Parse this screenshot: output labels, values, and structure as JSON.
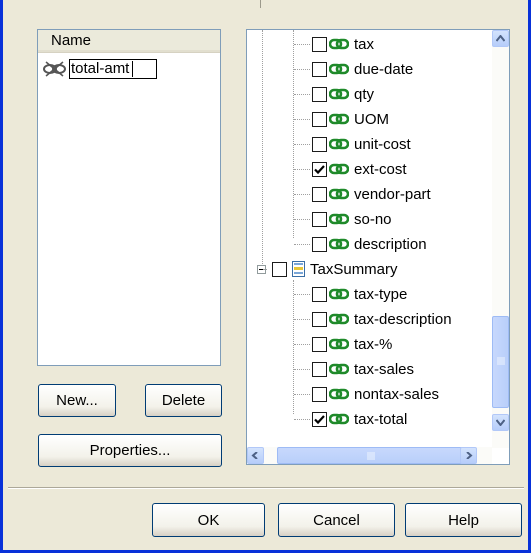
{
  "name_list": {
    "header": "Name",
    "items": [
      {
        "value": "total-amt",
        "icon": "linked-field-icon",
        "editing": true
      }
    ]
  },
  "buttons": {
    "new": "New...",
    "delete": "Delete",
    "properties": "Properties...",
    "ok": "OK",
    "cancel": "Cancel",
    "help": "Help"
  },
  "tree": {
    "items": [
      {
        "label": "tax",
        "checked": false,
        "icon": "link-icon",
        "level": 2
      },
      {
        "label": "due-date",
        "checked": false,
        "icon": "link-icon",
        "level": 2
      },
      {
        "label": "qty",
        "checked": false,
        "icon": "link-icon",
        "level": 2
      },
      {
        "label": "UOM",
        "checked": false,
        "icon": "link-icon",
        "level": 2
      },
      {
        "label": "unit-cost",
        "checked": false,
        "icon": "link-icon",
        "level": 2
      },
      {
        "label": "ext-cost",
        "checked": true,
        "icon": "link-icon",
        "level": 2
      },
      {
        "label": "vendor-part",
        "checked": false,
        "icon": "link-icon",
        "level": 2
      },
      {
        "label": "so-no",
        "checked": false,
        "icon": "link-icon",
        "level": 2
      },
      {
        "label": "description",
        "checked": false,
        "icon": "link-icon",
        "level": 2
      },
      {
        "label": "TaxSummary",
        "checked": false,
        "icon": "group-icon",
        "level": 1,
        "expanded": true
      },
      {
        "label": "tax-type",
        "checked": false,
        "icon": "link-icon",
        "level": 2
      },
      {
        "label": "tax-description",
        "checked": false,
        "icon": "link-icon",
        "level": 2
      },
      {
        "label": "tax-%",
        "checked": false,
        "icon": "link-icon",
        "level": 2
      },
      {
        "label": "tax-sales",
        "checked": false,
        "icon": "link-icon",
        "level": 2
      },
      {
        "label": "nontax-sales",
        "checked": false,
        "icon": "link-icon",
        "level": 2
      },
      {
        "label": "tax-total",
        "checked": true,
        "icon": "link-icon",
        "level": 2
      }
    ]
  },
  "colors": {
    "dialog_bg": "#ece9d8",
    "link_green": "#1f8a2a",
    "frame_blue": "#0831d9",
    "scroll_blue": "#b6cdfa"
  }
}
